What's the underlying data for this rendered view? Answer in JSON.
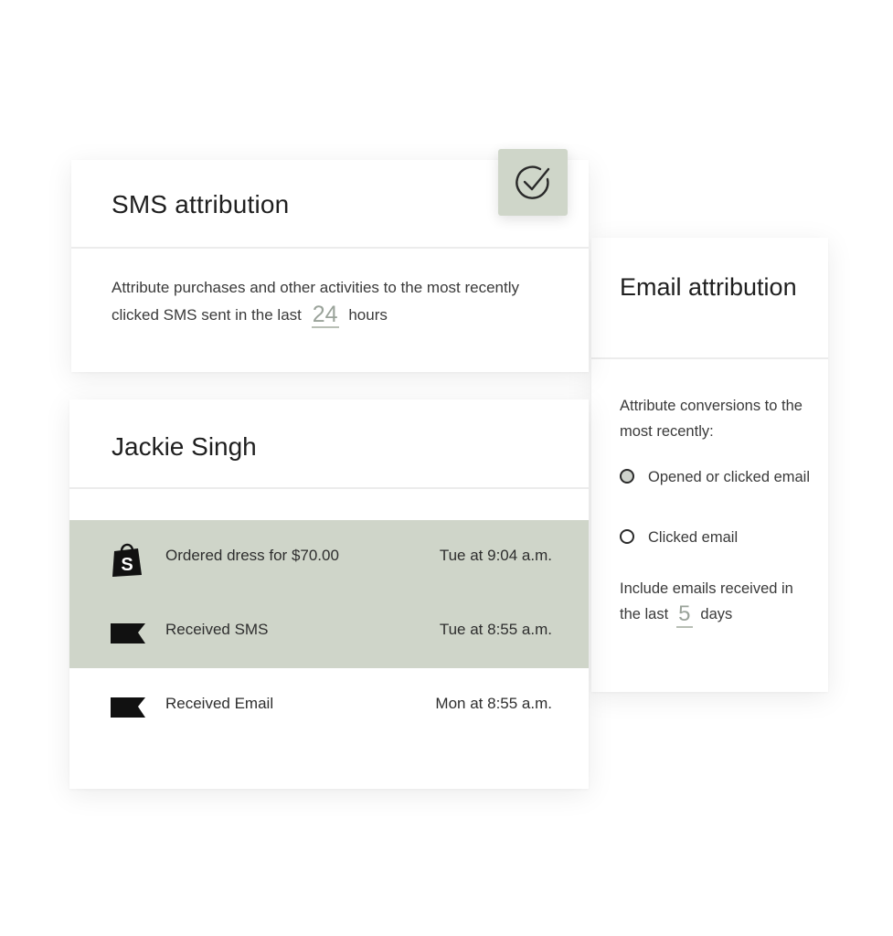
{
  "sms_card": {
    "title": "SMS attribution",
    "desc_prefix": "Attribute purchases and other activities to the most recently clicked SMS sent in the last",
    "hours_value": "24",
    "hours_unit": "hours"
  },
  "profile": {
    "name": "Jackie Singh",
    "events": [
      {
        "icon": "shopify-bag-icon",
        "label": "Ordered dress for $70.00",
        "time": "Tue at 9:04 a.m.",
        "highlighted": true
      },
      {
        "icon": "flag-icon",
        "label": "Received SMS",
        "time": "Tue at 8:55 a.m.",
        "highlighted": true
      },
      {
        "icon": "flag-icon",
        "label": "Received Email",
        "time": "Mon at 8:55 a.m.",
        "highlighted": false
      }
    ]
  },
  "email_card": {
    "title": "Email attribution",
    "desc": "Attribute conversions to the most recently:",
    "options": [
      {
        "label": "Opened or clicked email",
        "selected": true
      },
      {
        "label": "Clicked email",
        "selected": false
      }
    ],
    "include_prefix": "Include emails received in the last",
    "days_value": "5",
    "days_unit": "days"
  },
  "colors": {
    "highlight": "#cfd5c9",
    "badge": "#cfd6c9",
    "underline_value": "#9aa39a"
  }
}
